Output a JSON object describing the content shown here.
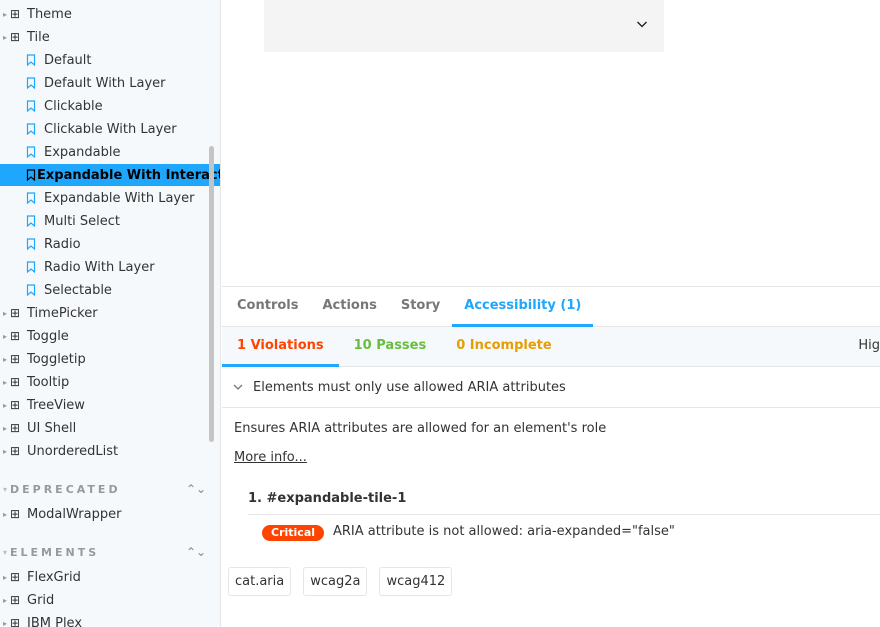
{
  "sidebar": {
    "tree": [
      {
        "label": "Theme",
        "kind": "component"
      },
      {
        "label": "Tile",
        "kind": "component"
      },
      {
        "label": "Default",
        "kind": "story"
      },
      {
        "label": "Default With Layer",
        "kind": "story"
      },
      {
        "label": "Clickable",
        "kind": "story"
      },
      {
        "label": "Clickable With Layer",
        "kind": "story"
      },
      {
        "label": "Expandable",
        "kind": "story"
      },
      {
        "label": "Expandable With Interactive",
        "kind": "story",
        "selected": true
      },
      {
        "label": "Expandable With Layer",
        "kind": "story"
      },
      {
        "label": "Multi Select",
        "kind": "story"
      },
      {
        "label": "Radio",
        "kind": "story"
      },
      {
        "label": "Radio With Layer",
        "kind": "story"
      },
      {
        "label": "Selectable",
        "kind": "story"
      },
      {
        "label": "TimePicker",
        "kind": "component"
      },
      {
        "label": "Toggle",
        "kind": "component"
      },
      {
        "label": "Toggletip",
        "kind": "component"
      },
      {
        "label": "Tooltip",
        "kind": "component"
      },
      {
        "label": "TreeView",
        "kind": "component"
      },
      {
        "label": "UI Shell",
        "kind": "component"
      },
      {
        "label": "UnorderedList",
        "kind": "component"
      }
    ],
    "deprecated_heading": "DEPRECATED",
    "deprecated_items": [
      {
        "label": "ModalWrapper"
      }
    ],
    "elements_heading": "ELEMENTS",
    "elements_items": [
      {
        "label": "FlexGrid"
      },
      {
        "label": "Grid"
      },
      {
        "label": "IBM Plex"
      }
    ]
  },
  "panel": {
    "tabs": [
      {
        "label": "Controls",
        "active": false
      },
      {
        "label": "Actions",
        "active": false
      },
      {
        "label": "Story",
        "active": false
      },
      {
        "label": "Accessibility (1)",
        "active": true
      }
    ],
    "subtabs": {
      "violations": "1 Violations",
      "passes": "10 Passes",
      "incomplete": "0 Incomplete",
      "highlight": "Hig"
    },
    "rule_title": "Elements must only use allowed ARIA attributes",
    "description": "Ensures ARIA attributes are allowed for an element's role",
    "more_info": "More info...",
    "node": "1. #expandable-tile-1",
    "impact": "Critical",
    "message": "ARIA attribute is not allowed: aria-expanded=\"false\"",
    "tags": [
      "cat.aria",
      "wcag2a",
      "wcag412"
    ]
  },
  "colors": {
    "accent": "#1ea7fd",
    "violation": "#ff4400",
    "pass": "#66bf3c",
    "incomplete": "#e69d00"
  }
}
